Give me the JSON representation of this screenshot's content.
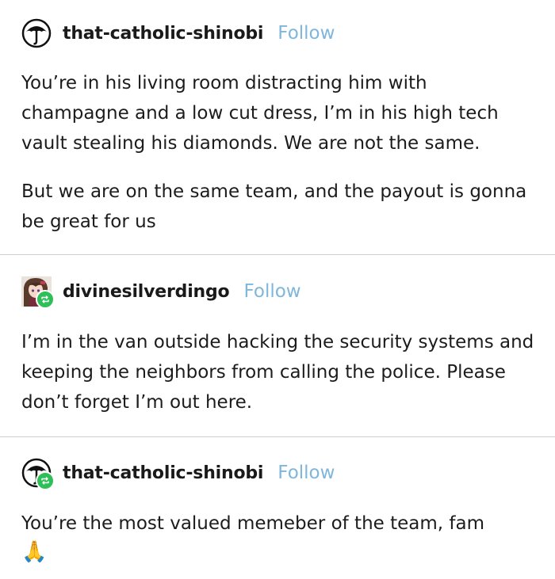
{
  "posts": [
    {
      "username": "that-catholic-shinobi",
      "follow_label": "Follow",
      "avatar_icon": "umbrella-icon",
      "paragraphs": [
        "You’re in his living room distracting him with champagne and a low cut dress, I’m in his high tech vault stealing his diamonds. We are not the same.",
        "But we are on the same team, and the payout is gonna be great for us"
      ]
    },
    {
      "username": "divinesilverdingo",
      "follow_label": "Follow",
      "avatar_icon": "anime-avatar-icon",
      "paragraphs": [
        "I’m in the van outside hacking the security systems and keeping the neighbors from calling the police. Please don’t forget I’m out here."
      ]
    },
    {
      "username": "that-catholic-shinobi",
      "follow_label": "Follow",
      "avatar_icon": "umbrella-icon",
      "paragraphs": [
        "You’re the most valued memeber of the team, fam"
      ],
      "emoji": "🙏"
    }
  ],
  "colors": {
    "follow": "#7fb6dc",
    "reblog_badge": "#2fbf58",
    "divider": "#cfcfcf"
  }
}
